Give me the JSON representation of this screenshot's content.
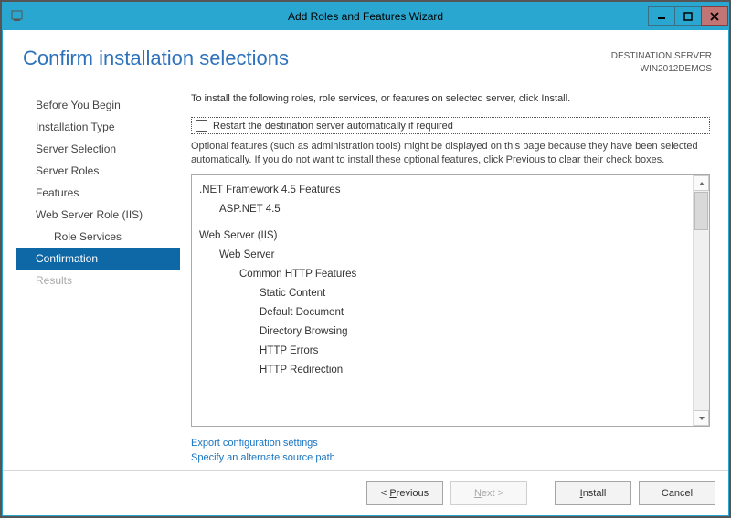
{
  "window": {
    "title": "Add Roles and Features Wizard"
  },
  "header": {
    "page_title": "Confirm installation selections",
    "dest_label": "DESTINATION SERVER",
    "dest_server": "WIN2012DEMOS"
  },
  "nav": {
    "items": [
      {
        "label": "Before You Begin",
        "sub": false,
        "selected": false,
        "enabled": true
      },
      {
        "label": "Installation Type",
        "sub": false,
        "selected": false,
        "enabled": true
      },
      {
        "label": "Server Selection",
        "sub": false,
        "selected": false,
        "enabled": true
      },
      {
        "label": "Server Roles",
        "sub": false,
        "selected": false,
        "enabled": true
      },
      {
        "label": "Features",
        "sub": false,
        "selected": false,
        "enabled": true
      },
      {
        "label": "Web Server Role (IIS)",
        "sub": false,
        "selected": false,
        "enabled": true
      },
      {
        "label": "Role Services",
        "sub": true,
        "selected": false,
        "enabled": true
      },
      {
        "label": "Confirmation",
        "sub": false,
        "selected": true,
        "enabled": true
      },
      {
        "label": "Results",
        "sub": false,
        "selected": false,
        "enabled": false
      }
    ]
  },
  "content": {
    "instruction": "To install the following roles, role services, or features on selected server, click Install.",
    "restart_label": "Restart the destination server automatically if required",
    "restart_checked": false,
    "optional_note": "Optional features (such as administration tools) might be displayed on this page because they have been selected automatically. If you do not want to install these optional features, click Previous to clear their check boxes.",
    "selections": [
      {
        "label": ".NET Framework 4.5 Features",
        "indent": 0
      },
      {
        "label": "ASP.NET 4.5",
        "indent": 1
      },
      {
        "label": "Web Server (IIS)",
        "indent": 0
      },
      {
        "label": "Web Server",
        "indent": 1
      },
      {
        "label": "Common HTTP Features",
        "indent": 2
      },
      {
        "label": "Static Content",
        "indent": 3
      },
      {
        "label": "Default Document",
        "indent": 3
      },
      {
        "label": "Directory Browsing",
        "indent": 3
      },
      {
        "label": "HTTP Errors",
        "indent": 3
      },
      {
        "label": "HTTP Redirection",
        "indent": 3
      }
    ],
    "link_export": "Export configuration settings",
    "link_source": "Specify an alternate source path"
  },
  "footer": {
    "previous": "< Previous",
    "next": "Next >",
    "install_pre": "I",
    "install_post": "nstall",
    "cancel": "Cancel"
  }
}
